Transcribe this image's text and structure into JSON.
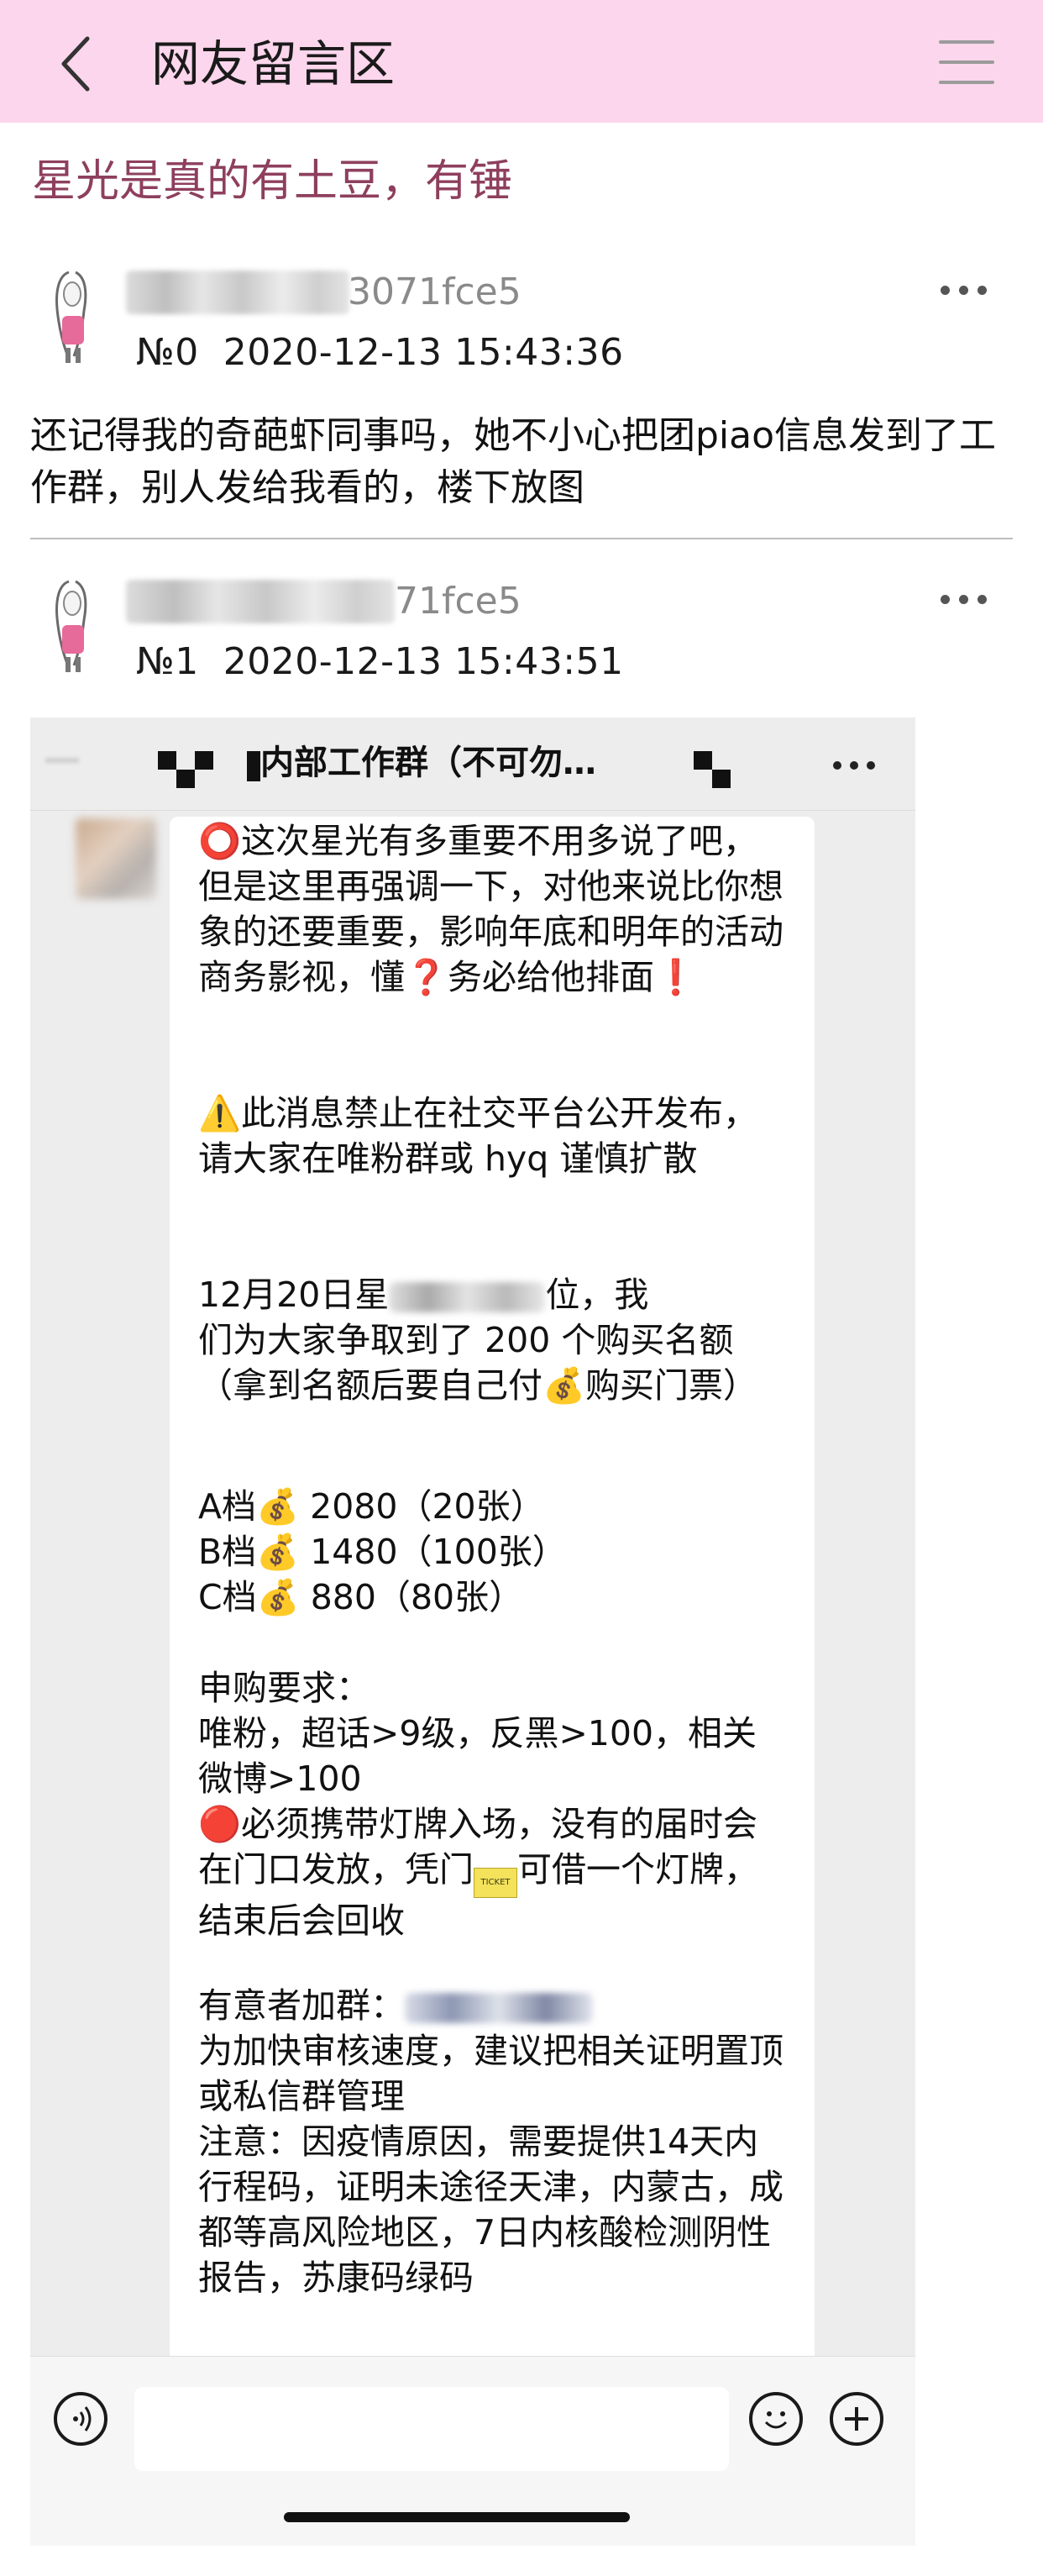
{
  "header": {
    "title": "网友留言区",
    "background": "#fcd6ec",
    "back_icon": "chevron-left-icon",
    "menu_icon": "hamburger-menu-icon"
  },
  "thread": {
    "title": "星光是真的有土豆，有锤",
    "title_color": "#8e3f5d"
  },
  "posts": [
    {
      "user_suffix": "3071fce5",
      "floor": "№0",
      "timestamp": "2020-12-13 15:43:36",
      "body": "还记得我的奇葩虾同事吗，她不小心把团piao信息发到了工作群，别人发给我看的，楼下放图"
    },
    {
      "user_suffix": "71fce5",
      "floor": "№1",
      "timestamp": "2020-12-13 15:43:51"
    }
  ],
  "chat": {
    "group_title": "内部工作群（不可勿…",
    "messages": {
      "p1": "⭕这次星光有多重要不用多说了吧，但是这里再强调一下，对他来说比你想象的还要重要，影响年底和明年的活动商务影视，懂❓务必给他排面❗",
      "p2": "⚠️此消息禁止在社交平台公开发布，请大家在唯粉群或 hyq 谨慎扩散",
      "p3_line1": "12月20日星",
      "p3_line1_tail": "位，我",
      "p3_rest": "们为大家争取到了 200 个购买名额（拿到名额后要自己付💰购买门票）",
      "tier_a": "A档💰 2080（20张）",
      "tier_b": "B档💰 1480（100张）",
      "tier_c": "C档💰 880（80张）",
      "req_title": "申购要求：",
      "req_body": "唯粉，超话>9级，反黑>100，相关微博>100",
      "req_light": "🔴必须携带灯牌入场，没有的届时会在门口发放，凭门",
      "req_light_tail": "可借一个灯牌，结束后会回收",
      "join_label": "有意者加群：",
      "join_body": "为加快审核速度，建议把相关证明置顶或私信群管理",
      "note": "注意：因疫情原因，需要提供14天内行程码，证明未途径天津，内蒙古，成都等高风险地区，7日内核酸检测阴性报告，苏康码绿码"
    }
  }
}
